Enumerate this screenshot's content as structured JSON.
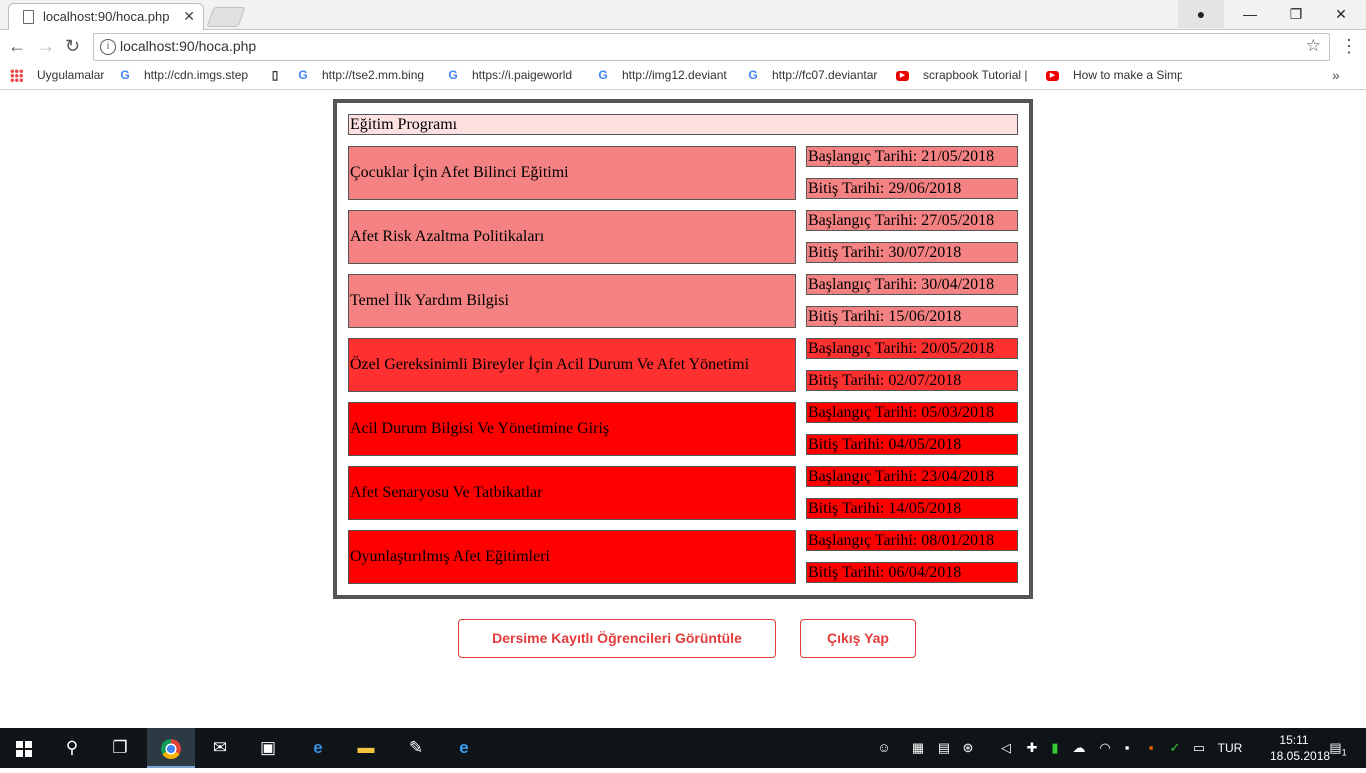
{
  "browser": {
    "tab_title": "localhost:90/hoca.php",
    "url": "localhost:90/hoca.php",
    "bookmarks": [
      {
        "label": "Uygulamalar",
        "icon": "apps-grid-icon"
      },
      {
        "label": "http://cdn.imgs.step",
        "icon": "google-icon"
      },
      {
        "label": "",
        "icon": "page-icon"
      },
      {
        "label": "http://tse2.mm.bing",
        "icon": "google-icon"
      },
      {
        "label": "https://i.paigeworld",
        "icon": "google-icon"
      },
      {
        "label": "http://img12.deviant",
        "icon": "google-icon"
      },
      {
        "label": "http://fc07.deviantar",
        "icon": "google-icon"
      },
      {
        "label": "scrapbook Tutorial |",
        "icon": "youtube-icon"
      },
      {
        "label": "How to make a Simp",
        "icon": "youtube-icon"
      }
    ]
  },
  "page": {
    "program_title": "Eğitim Programı",
    "courses": [
      {
        "name": "Çocuklar İçin Afet Bilinci Eğitimi",
        "start": "Başlangıç Tarihi: 21/05/2018",
        "end": "Bitiş Tarihi: 29/06/2018",
        "color": "#f48282"
      },
      {
        "name": "Afet Risk Azaltma Politikaları",
        "start": "Başlangıç Tarihi: 27/05/2018",
        "end": "Bitiş Tarihi: 30/07/2018",
        "color": "#f48282"
      },
      {
        "name": "Temel İlk Yardım Bilgisi",
        "start": "Başlangıç Tarihi: 30/04/2018",
        "end": "Bitiş Tarihi: 15/06/2018",
        "color": "#f48282"
      },
      {
        "name": "Özel Gereksinimli Bireyler İçin Acil Durum Ve Afet Yönetimi",
        "start": "Başlangıç Tarihi: 20/05/2018",
        "end": "Bitiş Tarihi: 02/07/2018",
        "color": "#ff3030"
      },
      {
        "name": "Acil Durum Bilgisi Ve Yönetimine Giriş",
        "start": "Başlangıç Tarihi: 05/03/2018",
        "end": "Bitiş Tarihi: 04/05/2018",
        "color": "#ff0000"
      },
      {
        "name": "Afet Senaryosu Ve Tatbikatlar",
        "start": "Başlangıç Tarihi: 23/04/2018",
        "end": "Bitiş Tarihi: 14/05/2018",
        "color": "#ff0000"
      },
      {
        "name": "Oyunlaştırılmış Afet Eğitimleri",
        "start": "Başlangıç Tarihi: 08/01/2018",
        "end": "Bitiş Tarihi: 06/04/2018",
        "color": "#ff0000"
      }
    ],
    "buttons": {
      "students": "Dersime Kayıtlı Öğrencileri Görüntüle",
      "logout": "Çıkış Yap"
    },
    "accent": "#e23b3b"
  },
  "taskbar": {
    "language": "TUR",
    "time": "15:11",
    "date": "18.05.2018",
    "notification_count": "1"
  }
}
